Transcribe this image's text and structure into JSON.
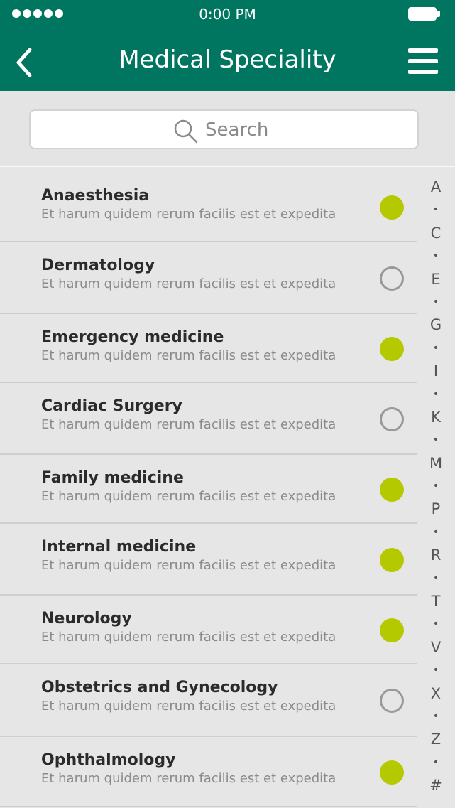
{
  "status_bar": {
    "time": "0:00 PM"
  },
  "header": {
    "title": "Medical Speciality"
  },
  "search": {
    "placeholder": "Search"
  },
  "items": [
    {
      "name": "Anaesthesia",
      "desc": "Et harum quidem rerum facilis est et expedita",
      "selected": true
    },
    {
      "name": "Dermatology",
      "desc": "Et harum quidem rerum facilis est et expedita",
      "selected": false
    },
    {
      "name": "Emergency medicine",
      "desc": "Et harum quidem rerum facilis est et expedita",
      "selected": true
    },
    {
      "name": "Cardiac Surgery",
      "desc": "Et harum quidem rerum facilis est et expedita",
      "selected": false
    },
    {
      "name": "Family medicine",
      "desc": "Et harum quidem rerum facilis est et expedita",
      "selected": true
    },
    {
      "name": "Internal medicine",
      "desc": "Et harum quidem rerum facilis est et expedita",
      "selected": true
    },
    {
      "name": "Neurology",
      "desc": "Et harum quidem rerum facilis est et expedita",
      "selected": true
    },
    {
      "name": "Obstetrics and Gynecology",
      "desc": "Et harum quidem rerum facilis est et expedita",
      "selected": false
    },
    {
      "name": "Ophthalmology",
      "desc": "Et harum quidem rerum facilis est et expedita",
      "selected": true
    }
  ],
  "index": [
    "A",
    "•",
    "C",
    "•",
    "E",
    "•",
    "G",
    "•",
    "I",
    "•",
    "K",
    "•",
    "M",
    "•",
    "P",
    "•",
    "R",
    "•",
    "T",
    "•",
    "V",
    "•",
    "X",
    "•",
    "Z",
    "•",
    "#"
  ],
  "colors": {
    "header": "#007560",
    "selected": "#b4c900"
  }
}
